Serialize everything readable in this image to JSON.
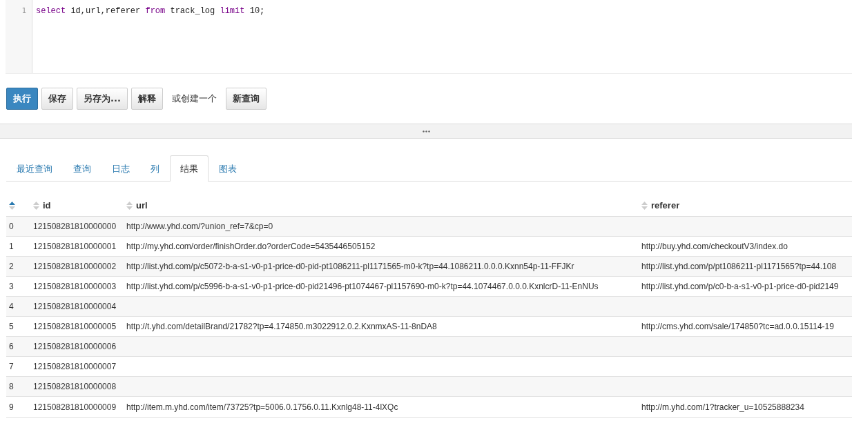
{
  "editor": {
    "lines": [
      {
        "number": "1",
        "tokens": [
          {
            "text": "select",
            "kind": "keyword"
          },
          {
            "text": " id,url,referer ",
            "kind": "plain"
          },
          {
            "text": "from",
            "kind": "keyword"
          },
          {
            "text": " track_log ",
            "kind": "plain"
          },
          {
            "text": "limit",
            "kind": "keyword"
          },
          {
            "text": " 10;",
            "kind": "plain"
          }
        ]
      }
    ]
  },
  "toolbar": [
    {
      "kind": "primary",
      "label": "执行"
    },
    {
      "kind": "button",
      "label": "保存"
    },
    {
      "kind": "button",
      "label": "另存为..."
    },
    {
      "kind": "button",
      "label": "解释"
    },
    {
      "kind": "text",
      "label": "或创建一个"
    },
    {
      "kind": "button",
      "label": "新查询"
    }
  ],
  "tabs": [
    {
      "label": "最近查询",
      "selected": false
    },
    {
      "label": "查询",
      "selected": false
    },
    {
      "label": "日志",
      "selected": false
    },
    {
      "label": "列",
      "selected": false
    },
    {
      "label": "结果",
      "selected": true
    },
    {
      "label": "图表",
      "selected": false
    }
  ],
  "table": {
    "columns": [
      {
        "sorted": true
      },
      {
        "label": "id",
        "sorted": false
      },
      {
        "label": "url",
        "sorted": false
      },
      {
        "label": "referer",
        "sorted": false
      }
    ],
    "rows": [
      [
        "0",
        "121508281810000000",
        "http://www.yhd.com/?union_ref=7&cp=0",
        ""
      ],
      [
        "1",
        "121508281810000001",
        "http://my.yhd.com/order/finishOrder.do?orderCode=5435446505152",
        "http://buy.yhd.com/checkoutV3/index.do"
      ],
      [
        "2",
        "121508281810000002",
        "http://list.yhd.com/p/c5072-b-a-s1-v0-p1-price-d0-pid-pt1086211-pl1171565-m0-k?tp=44.1086211.0.0.0.Kxnn54p-11-FFJKr",
        "http://list.yhd.com/p/pt1086211-pl1171565?tp=44.108"
      ],
      [
        "3",
        "121508281810000003",
        "http://list.yhd.com/p/c5996-b-a-s1-v0-p1-price-d0-pid21496-pt1074467-pl1157690-m0-k?tp=44.1074467.0.0.0.KxnlcrD-11-EnNUs",
        "http://list.yhd.com/p/c0-b-a-s1-v0-p1-price-d0-pid2149"
      ],
      [
        "4",
        "121508281810000004",
        "",
        ""
      ],
      [
        "5",
        "121508281810000005",
        "http://t.yhd.com/detailBrand/21782?tp=4.174850.m3022912.0.2.KxnmxAS-11-8nDA8",
        "http://cms.yhd.com/sale/174850?tc=ad.0.0.15114-19"
      ],
      [
        "6",
        "121508281810000006",
        "",
        ""
      ],
      [
        "7",
        "121508281810000007",
        "",
        ""
      ],
      [
        "8",
        "121508281810000008",
        "",
        ""
      ],
      [
        "9",
        "121508281810000009",
        "http://item.m.yhd.com/item/73725?tp=5006.0.1756.0.11.Kxnlg48-11-4lXQc",
        "http://m.yhd.com/1?tracker_u=10525888234"
      ]
    ]
  }
}
